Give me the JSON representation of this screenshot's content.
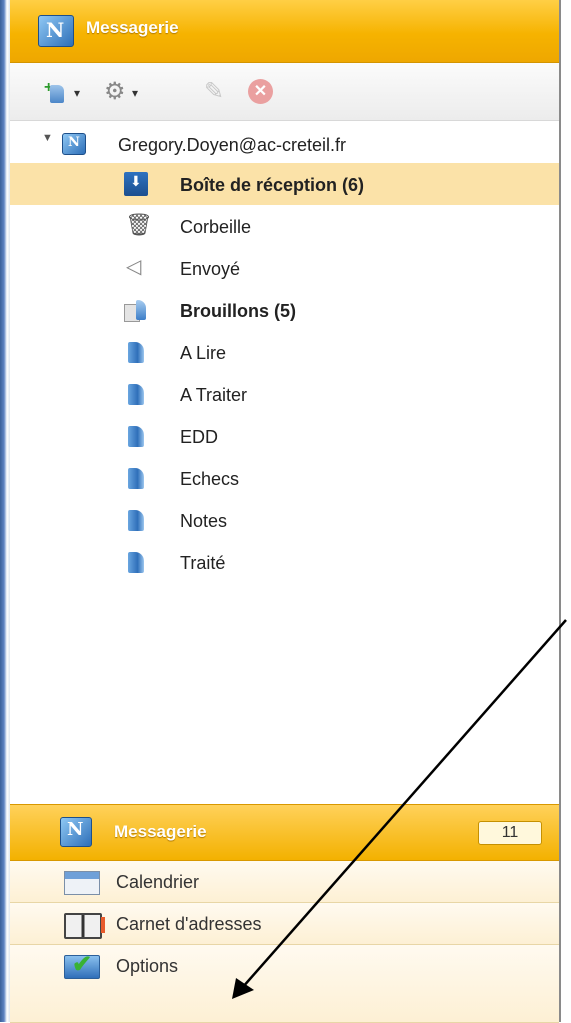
{
  "header": {
    "title": "Messagerie"
  },
  "toolbar": {
    "new_dropdown": "▾",
    "settings_dropdown": "▾",
    "delete_symbol": "✕"
  },
  "account": {
    "expander": "▼",
    "email": "Gregory.Doyen@ac-creteil.fr"
  },
  "folders": [
    {
      "label": "Boîte de réception (6)",
      "icon": "inbox-icon",
      "bold": true,
      "selected": true
    },
    {
      "label": "Corbeille",
      "icon": "trash-icon"
    },
    {
      "label": "Envoyé",
      "icon": "sent-icon"
    },
    {
      "label": "Brouillons (5)",
      "icon": "drafts-icon",
      "bold": true
    },
    {
      "label": "A Lire",
      "icon": "folder-icon"
    },
    {
      "label": "A Traiter",
      "icon": "folder-icon"
    },
    {
      "label": "EDD",
      "icon": "folder-icon"
    },
    {
      "label": "Echecs",
      "icon": "folder-icon"
    },
    {
      "label": "Notes",
      "icon": "folder-icon"
    },
    {
      "label": "Traité",
      "icon": "folder-icon"
    }
  ],
  "nav": {
    "messagerie": {
      "label": "Messagerie",
      "count": "11"
    },
    "calendrier": {
      "label": "Calendrier"
    },
    "carnet": {
      "label": "Carnet d'adresses"
    },
    "options": {
      "label": "Options"
    }
  },
  "colors": {
    "accent": "#f6b300",
    "selected_row": "#fbe2a8",
    "annotation_arrow": "#000000"
  }
}
